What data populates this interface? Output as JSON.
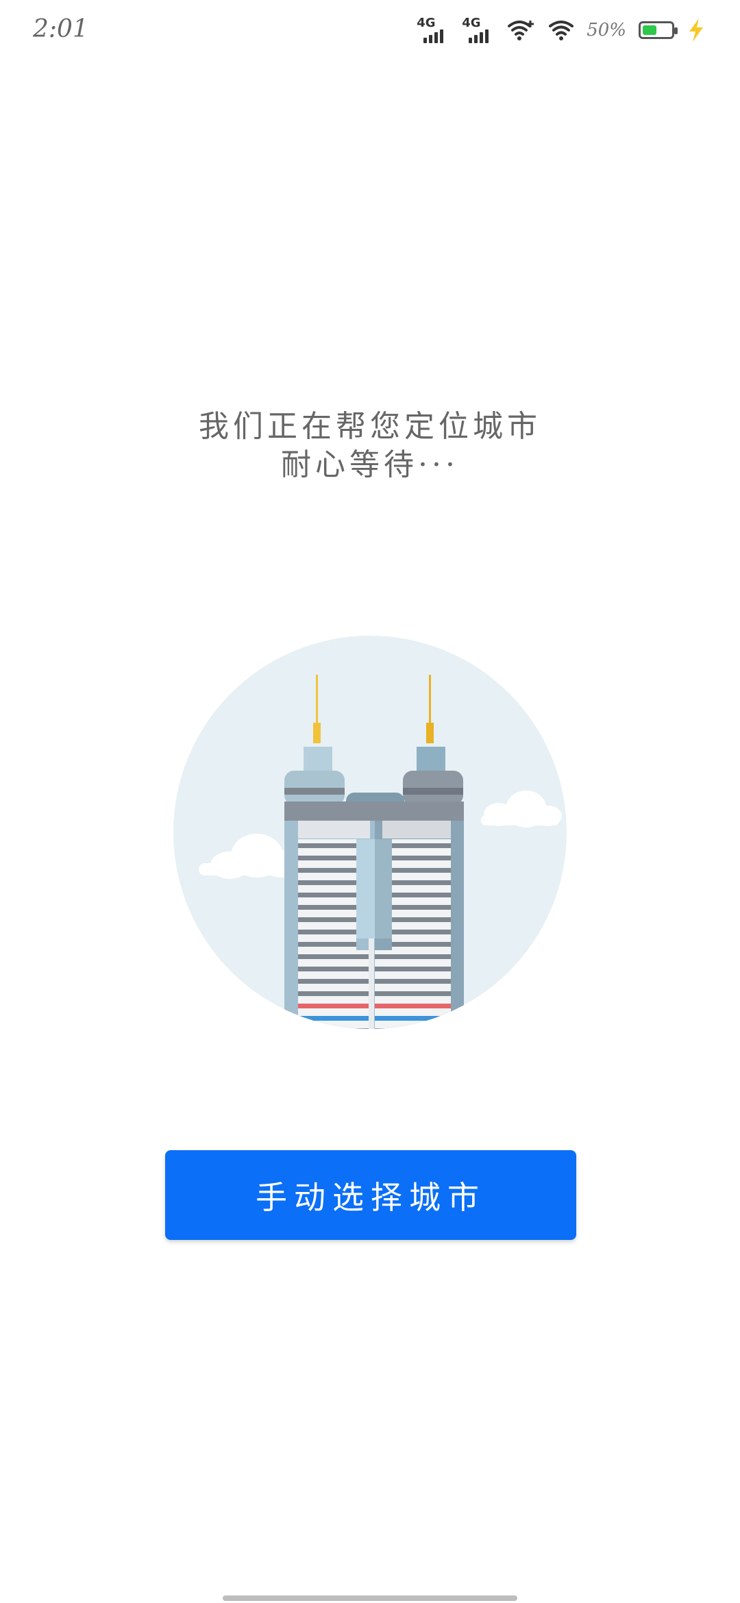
{
  "status_bar": {
    "time": "2:01",
    "network1": "4G",
    "network2": "4G",
    "battery_percent": "50%",
    "battery_level": 0.5,
    "icons": [
      "signal-4g-icon",
      "signal-4g-icon",
      "wifi-plus-icon",
      "wifi-icon",
      "battery-icon",
      "charging-bolt-icon"
    ]
  },
  "message": {
    "line1": "我们正在帮您定位城市",
    "line2": "耐心等待···"
  },
  "illustration": {
    "name": "twin-towers-illustration",
    "colors": {
      "circle": "#e7f0f4",
      "building": "#9fb8c6",
      "antenna": "#f2c23b",
      "stripe": "#7d858f",
      "red": "#e5656a",
      "blue": "#3d93d8"
    }
  },
  "button": {
    "label": "手动选择城市",
    "color": "#0b6ff7"
  }
}
